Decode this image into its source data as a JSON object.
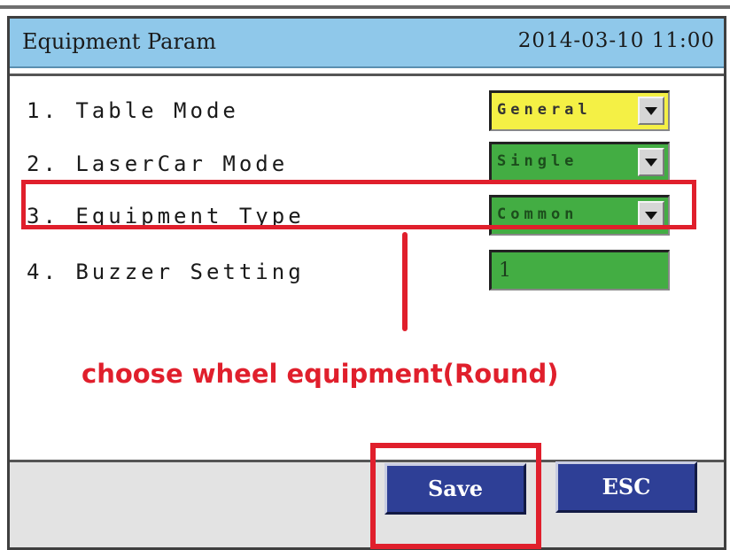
{
  "window": {
    "title": "Equipment Param",
    "datetime": "2014-03-10 11:00"
  },
  "params": [
    {
      "label": "1. Table Mode",
      "value": "General",
      "control": "dropdown",
      "color": "#f4f045"
    },
    {
      "label": "2. LaserCar Mode",
      "value": "Single",
      "control": "dropdown",
      "color": "#43ad43"
    },
    {
      "label": "3. Equipment Type",
      "value": "Common",
      "control": "dropdown",
      "color": "#43ad43"
    },
    {
      "label": "4. Buzzer Setting",
      "value": "1",
      "control": "input",
      "color": "#43ad43"
    }
  ],
  "annotation": {
    "text": "choose wheel equipment(Round)",
    "color": "#e01f2c"
  },
  "buttons": {
    "save": "Save",
    "esc": "ESC"
  },
  "icons": {
    "dropdown": "chevron-down-icon"
  }
}
